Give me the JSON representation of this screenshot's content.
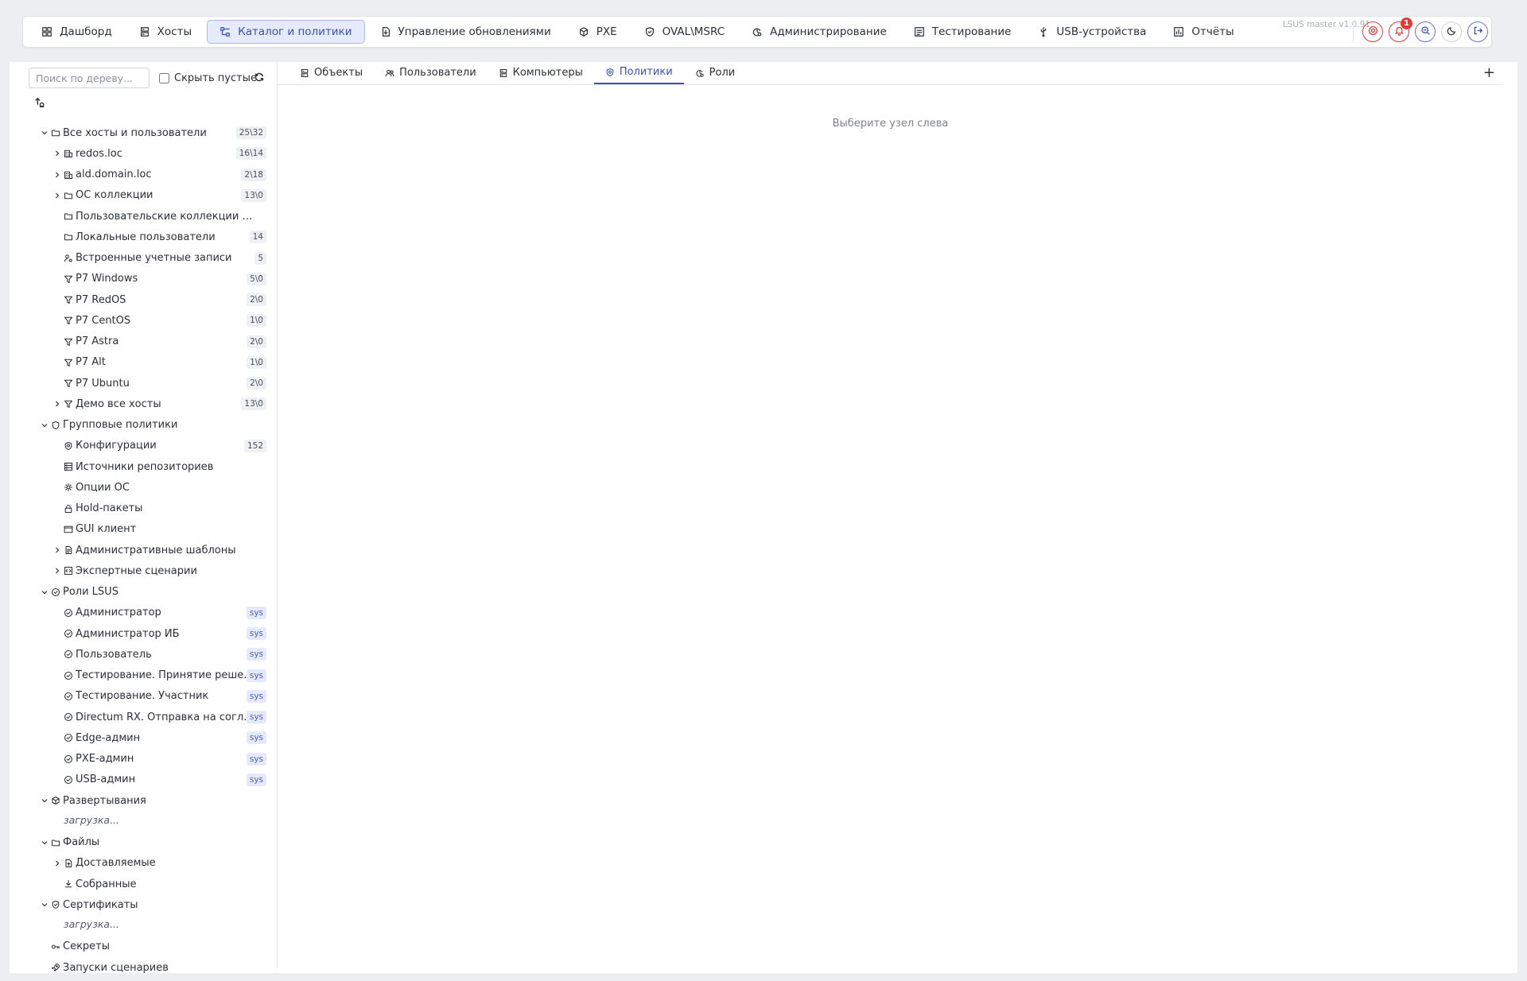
{
  "nav": {
    "items": [
      {
        "label": "Дашборд",
        "icon": "dashboard-icon",
        "active": false
      },
      {
        "label": "Хосты",
        "icon": "server-icon",
        "active": false
      },
      {
        "label": "Каталог и политики",
        "icon": "catalog-icon",
        "active": true
      },
      {
        "label": "Управление обновлениями",
        "icon": "update-file-icon",
        "active": false
      },
      {
        "label": "PXE",
        "icon": "cube-icon",
        "active": false
      },
      {
        "label": "OVAL\\MSRC",
        "icon": "shield-check-icon",
        "active": false
      },
      {
        "label": "Администрирование",
        "icon": "admin-gear-icon",
        "active": false
      },
      {
        "label": "Тестирование",
        "icon": "test-list-icon",
        "active": false
      },
      {
        "label": "USB-устройства",
        "icon": "usb-icon",
        "active": false
      },
      {
        "label": "Отчёты",
        "icon": "report-chart-icon",
        "active": false
      }
    ],
    "version": "LSUS master v1.0.91",
    "notification_count": "1",
    "accent_color": "#3b4fb8",
    "alert_color": "#e03b3b"
  },
  "sidebar": {
    "search_placeholder": "Поиск по дереву...",
    "hide_empty_label": "Скрыть пустые",
    "hide_empty_checked": false
  },
  "tree": [
    {
      "label": "Все хосты и пользователи",
      "count": "25\\32",
      "icon": "folder-icon",
      "level": 0,
      "expander": "down"
    },
    {
      "label": "redos.loc",
      "count": "16\\14",
      "icon": "building-icon",
      "level": 1,
      "expander": "right"
    },
    {
      "label": "ald.domain.loc",
      "count": "2\\18",
      "icon": "building-icon",
      "level": 1,
      "expander": "right"
    },
    {
      "label": "ОС коллекции",
      "count": "13\\0",
      "icon": "folder-icon",
      "level": 1,
      "expander": "right"
    },
    {
      "label": "Пользовательские коллекции LSUS",
      "count": "",
      "icon": "folder-icon",
      "level": 1,
      "expander": ""
    },
    {
      "label": "Локальные пользователи",
      "count": "14",
      "icon": "folder-icon",
      "level": 1,
      "expander": ""
    },
    {
      "label": "Встроенные учетные записи",
      "count": "5",
      "icon": "user-gear-icon",
      "level": 1,
      "expander": ""
    },
    {
      "label": "P7 Windows",
      "count": "5\\0",
      "icon": "filter-icon",
      "level": 1,
      "expander": ""
    },
    {
      "label": "P7 RedOS",
      "count": "2\\0",
      "icon": "filter-icon",
      "level": 1,
      "expander": ""
    },
    {
      "label": "P7 CentOS",
      "count": "1\\0",
      "icon": "filter-icon",
      "level": 1,
      "expander": ""
    },
    {
      "label": "P7 Astra",
      "count": "2\\0",
      "icon": "filter-icon",
      "level": 1,
      "expander": ""
    },
    {
      "label": "P7 Alt",
      "count": "1\\0",
      "icon": "filter-icon",
      "level": 1,
      "expander": ""
    },
    {
      "label": "P7 Ubuntu",
      "count": "2\\0",
      "icon": "filter-icon",
      "level": 1,
      "expander": ""
    },
    {
      "label": "Демо все хосты",
      "count": "13\\0",
      "icon": "filter-icon",
      "level": 1,
      "expander": "right"
    },
    {
      "label": "Групповые политики",
      "count": "",
      "icon": "shield-icon",
      "level": 0,
      "expander": "down"
    },
    {
      "label": "Конфигурации",
      "count": "152",
      "icon": "config-icon",
      "level": 1,
      "expander": ""
    },
    {
      "label": "Источники репозиториев",
      "count": "",
      "icon": "repository-icon",
      "level": 1,
      "expander": ""
    },
    {
      "label": "Опции ОС",
      "count": "",
      "icon": "gear-icon",
      "level": 1,
      "expander": ""
    },
    {
      "label": "Hold-пакеты",
      "count": "",
      "icon": "lock-icon",
      "level": 1,
      "expander": ""
    },
    {
      "label": "GUI клиент",
      "count": "",
      "icon": "window-icon",
      "level": 1,
      "expander": ""
    },
    {
      "label": "Административные шаблоны",
      "count": "",
      "icon": "document-icon",
      "level": 1,
      "expander": "right"
    },
    {
      "label": "Экспертные сценарии",
      "count": "",
      "icon": "code-icon",
      "level": 1,
      "expander": "right"
    },
    {
      "label": "Роли LSUS",
      "count": "",
      "icon": "role-check-icon",
      "level": 0,
      "expander": "down"
    },
    {
      "label": "Администратор",
      "count": "sys",
      "icon": "role-check-icon",
      "level": 1,
      "expander": ""
    },
    {
      "label": "Администратор ИБ",
      "count": "sys",
      "icon": "role-check-icon",
      "level": 1,
      "expander": ""
    },
    {
      "label": "Пользователь",
      "count": "sys",
      "icon": "role-check-icon",
      "level": 1,
      "expander": ""
    },
    {
      "label": "Тестирование. Принятие решений",
      "count": "sys",
      "icon": "role-check-icon",
      "level": 1,
      "expander": ""
    },
    {
      "label": "Тестирование. Участник",
      "count": "sys",
      "icon": "role-check-icon",
      "level": 1,
      "expander": ""
    },
    {
      "label": "Directum RX. Отправка на согласов...",
      "count": "sys",
      "icon": "role-check-icon",
      "level": 1,
      "expander": ""
    },
    {
      "label": "Edge-админ",
      "count": "sys",
      "icon": "role-check-icon",
      "level": 1,
      "expander": ""
    },
    {
      "label": "PXE-админ",
      "count": "sys",
      "icon": "role-check-icon",
      "level": 1,
      "expander": ""
    },
    {
      "label": "USB-админ",
      "count": "sys",
      "icon": "role-check-icon",
      "level": 1,
      "expander": ""
    },
    {
      "label": "Развертывания",
      "count": "",
      "icon": "package-icon",
      "level": 0,
      "expander": "down"
    },
    {
      "label": "загрузка...",
      "count": "",
      "icon": "",
      "level": 1,
      "expander": "",
      "loading": true
    },
    {
      "label": "Файлы",
      "count": "",
      "icon": "folder-icon",
      "level": 0,
      "expander": "down"
    },
    {
      "label": "Доставляемые",
      "count": "",
      "icon": "file-upload-icon",
      "level": 1,
      "expander": "right"
    },
    {
      "label": "Собранные",
      "count": "",
      "icon": "download-icon",
      "level": 1,
      "expander": ""
    },
    {
      "label": "Сертификаты",
      "count": "",
      "icon": "certificate-icon",
      "level": 0,
      "expander": "down"
    },
    {
      "label": "загрузка...",
      "count": "",
      "icon": "",
      "level": 1,
      "expander": "",
      "loading": true
    },
    {
      "label": "Секреты",
      "count": "",
      "icon": "key-icon",
      "level": 0,
      "expander": ""
    },
    {
      "label": "Запуски сценариев",
      "count": "",
      "icon": "rocket-icon",
      "level": 0,
      "expander": ""
    }
  ],
  "tabs": [
    {
      "label": "Объекты",
      "icon": "server-icon",
      "active": false
    },
    {
      "label": "Пользователи",
      "icon": "users-icon",
      "active": false
    },
    {
      "label": "Компьютеры",
      "icon": "server-icon",
      "active": false
    },
    {
      "label": "Политики",
      "icon": "config-icon",
      "active": true
    },
    {
      "label": "Роли",
      "icon": "admin-gear-icon",
      "active": false
    }
  ],
  "main": {
    "empty_hint": "Выберите узел слева",
    "add_tab_symbol": "+"
  }
}
